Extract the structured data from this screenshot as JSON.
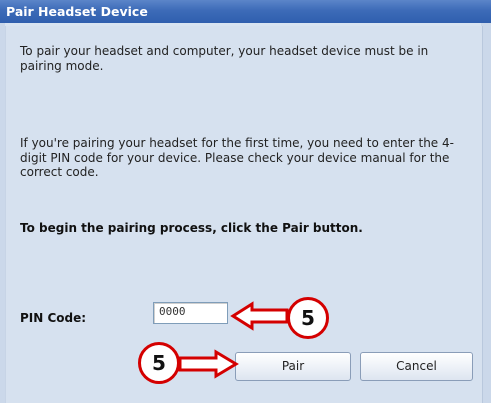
{
  "window": {
    "title": "Pair Headset Device"
  },
  "content": {
    "paragraph_1": "To pair your headset and computer, your headset device must be in pairing mode.",
    "paragraph_2": "If you're pairing your headset for the first time, you need to enter the 4-digit PIN code for your device. Please check your device manual for the correct code.",
    "paragraph_3": "To begin the pairing process, click the Pair button."
  },
  "pin": {
    "label": "PIN Code:",
    "value": "0000"
  },
  "buttons": {
    "pair_label": "Pair",
    "cancel_label": "Cancel"
  },
  "annotations": {
    "callout_pin": "5",
    "callout_pair": "5",
    "color": "#d40000"
  }
}
